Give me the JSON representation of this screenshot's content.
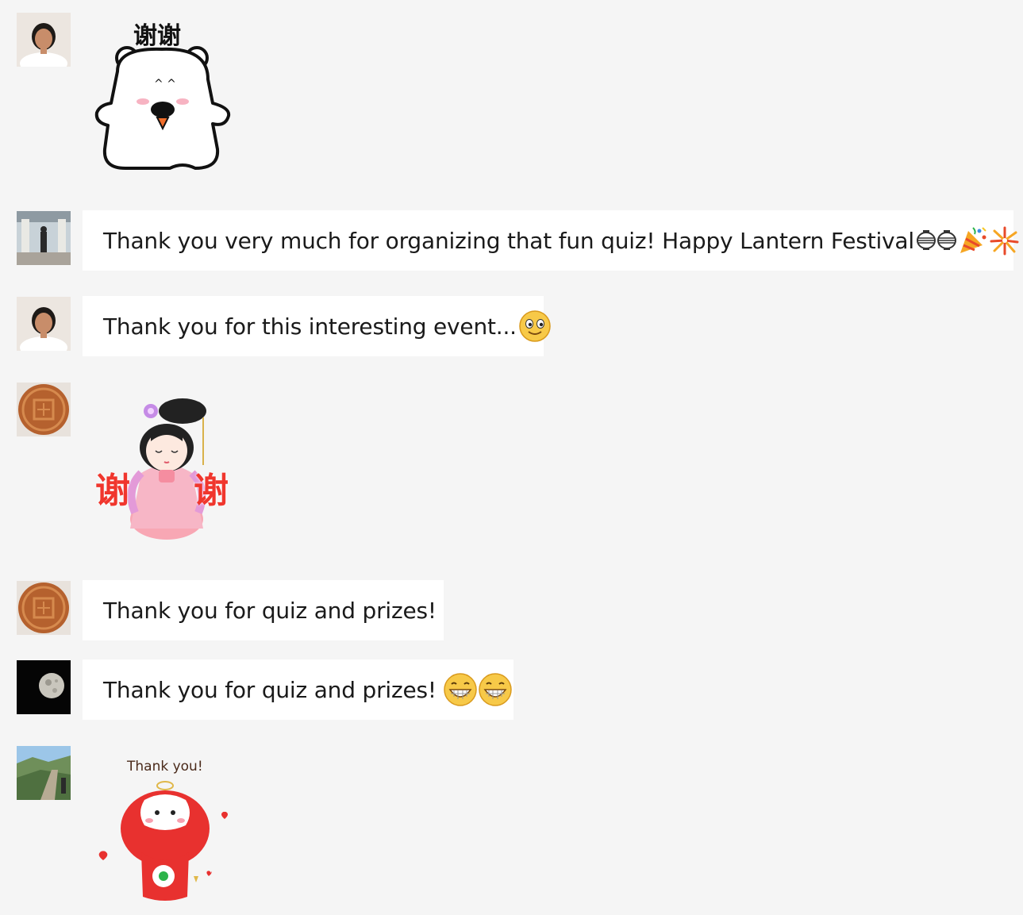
{
  "messages": [
    {
      "type": "sticker",
      "sticker_name": "polar-bear-thanks",
      "caption": "谢谢"
    },
    {
      "type": "text",
      "text": "Thank you very much for organizing that fun quiz! Happy Lantern Festival",
      "emojis": [
        "lantern-emoji",
        "lantern-emoji",
        "party-popper-emoji",
        "fireworks-emoji"
      ]
    },
    {
      "type": "text",
      "text": "Thank you for this interesting event...",
      "emojis": [
        "smile-emoji"
      ]
    },
    {
      "type": "sticker",
      "sticker_name": "tang-lady-thanks",
      "caption_left": "谢",
      "caption_right": "谢"
    },
    {
      "type": "text",
      "text": "Thank you for quiz and prizes!",
      "emojis": []
    },
    {
      "type": "text",
      "text": "Thank you for quiz and prizes!",
      "emojis": [
        "grin-emoji",
        "grin-emoji"
      ]
    },
    {
      "type": "sticker",
      "sticker_name": "red-lantern-mascot-thanks",
      "caption": "Thank you!"
    }
  ],
  "colors": {
    "background": "#f5f5f5",
    "bubble": "#ffffff",
    "text": "#1a1a1a",
    "sticker_red": "#e8312f"
  }
}
